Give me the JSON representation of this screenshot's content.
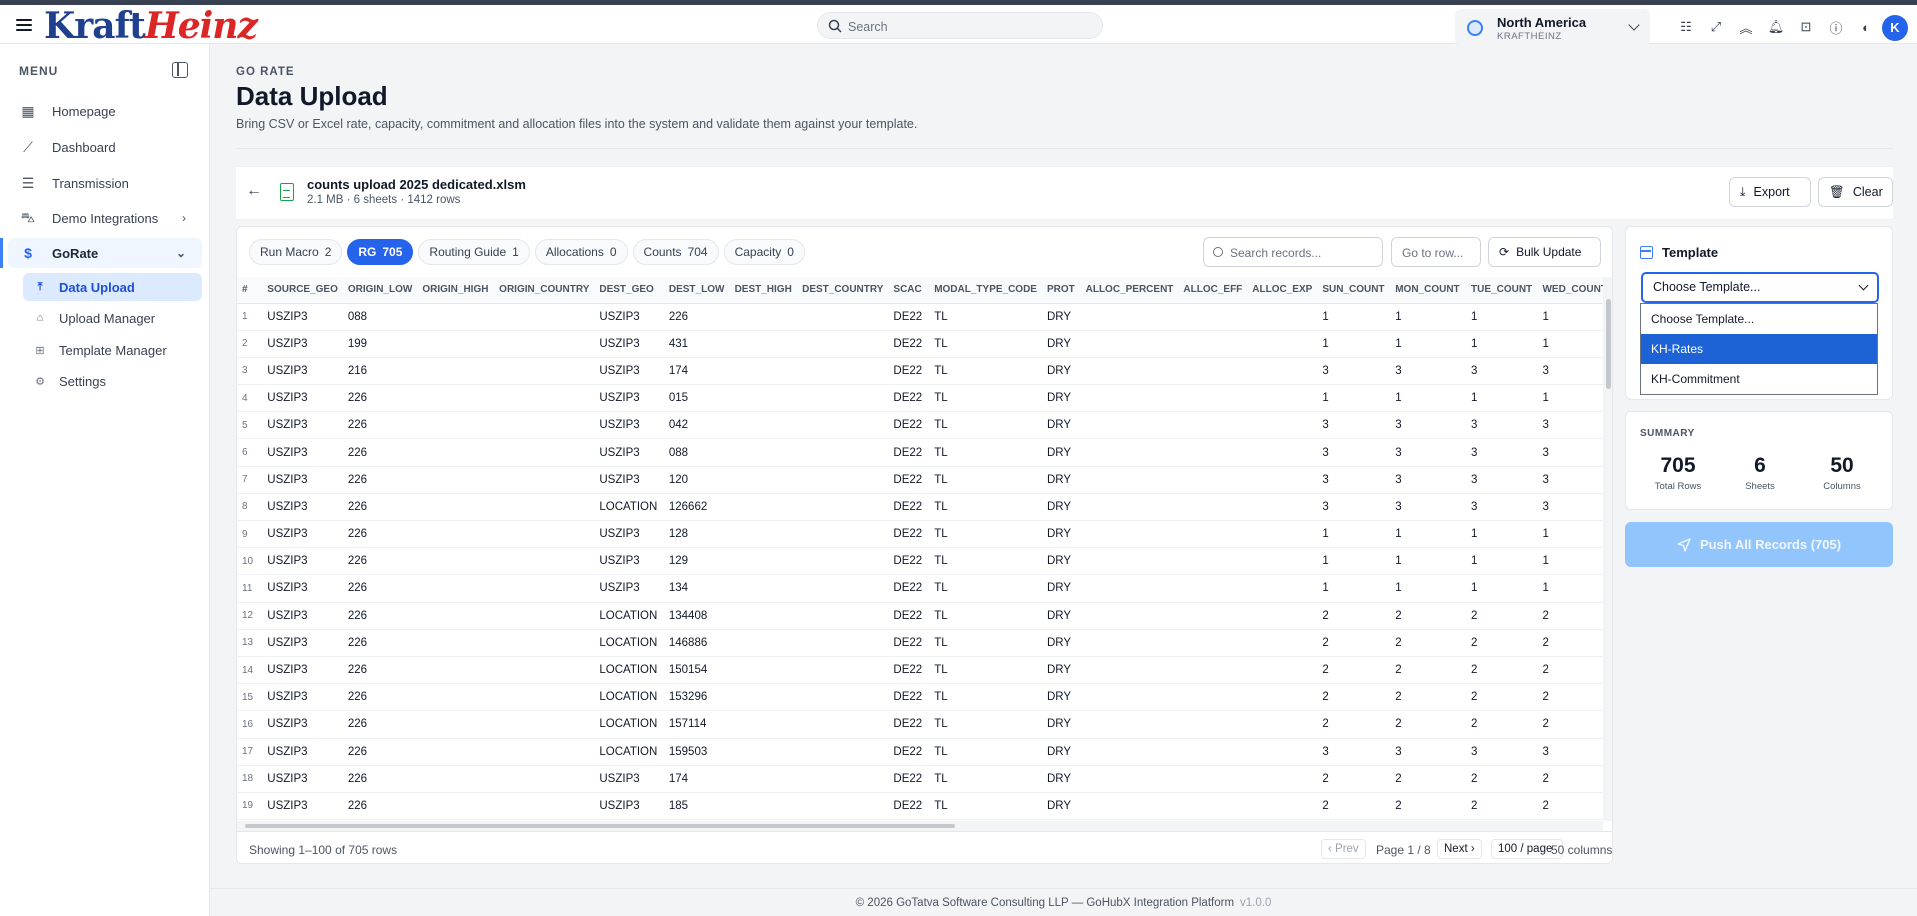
{
  "brand": {
    "part1": "Kraft",
    "part2": "Heinz"
  },
  "search": {
    "placeholder": "Search"
  },
  "region": {
    "name": "North America",
    "sub": "KRAFTHEINZ"
  },
  "avatar": "K",
  "sidebar": {
    "menu_label": "MENU",
    "items": [
      {
        "label": "Homepage",
        "icon": "building-icon"
      },
      {
        "label": "Dashboard",
        "icon": "chart-line-icon"
      },
      {
        "label": "Transmission",
        "icon": "server-icon"
      },
      {
        "label": "Demo Integrations",
        "icon": "car-icon"
      },
      {
        "label": "GoRate",
        "icon": "dollar-icon"
      }
    ],
    "subitems": [
      {
        "label": "Data Upload",
        "icon": "upload-icon"
      },
      {
        "label": "Upload Manager",
        "icon": "inbox-icon"
      },
      {
        "label": "Template Manager",
        "icon": "table-icon"
      },
      {
        "label": "Settings",
        "icon": "gear-icon"
      }
    ]
  },
  "page": {
    "crumb": "GO RATE",
    "title": "Data Upload",
    "description": "Bring CSV or Excel rate, capacity, commitment and allocation files into the system and validate them against your template."
  },
  "file": {
    "name": "counts upload 2025 dedicated.xlsm",
    "meta": "2.1 MB · 6 sheets · 1412 rows",
    "export_label": "Export",
    "clear_label": "Clear"
  },
  "tabs": [
    {
      "label": "Run Macro",
      "count": "2"
    },
    {
      "label": "RG",
      "count": "705"
    },
    {
      "label": "Routing Guide",
      "count": "1"
    },
    {
      "label": "Allocations",
      "count": "0"
    },
    {
      "label": "Counts",
      "count": "704"
    },
    {
      "label": "Capacity",
      "count": "0"
    }
  ],
  "table_tools": {
    "search_placeholder": "Search records...",
    "goto_placeholder": "Go to row...",
    "bulk_label": "Bulk Update"
  },
  "table": {
    "columns": [
      "#",
      "SOURCE_GEO",
      "ORIGIN_LOW",
      "ORIGIN_HIGH",
      "ORIGIN_COUNTRY",
      "DEST_GEO",
      "DEST_LOW",
      "DEST_HIGH",
      "DEST_COUNTRY",
      "SCAC",
      "MODAL_TYPE_CODE",
      "PROT",
      "ALLOC_PERCENT",
      "ALLOC_EFF",
      "ALLOC_EXP",
      "SUN_COUNT",
      "MON_COUNT",
      "TUE_COUNT",
      "WED_COUNT"
    ],
    "rows": [
      [
        "1",
        "USZIP3",
        "088",
        "",
        "",
        "USZIP3",
        "226",
        "",
        "",
        "DE22",
        "TL",
        "DRY",
        "",
        "",
        "",
        "1",
        "1",
        "1",
        "1"
      ],
      [
        "2",
        "USZIP3",
        "199",
        "",
        "",
        "USZIP3",
        "431",
        "",
        "",
        "DE22",
        "TL",
        "DRY",
        "",
        "",
        "",
        "1",
        "1",
        "1",
        "1"
      ],
      [
        "3",
        "USZIP3",
        "216",
        "",
        "",
        "USZIP3",
        "174",
        "",
        "",
        "DE22",
        "TL",
        "DRY",
        "",
        "",
        "",
        "3",
        "3",
        "3",
        "3"
      ],
      [
        "4",
        "USZIP3",
        "226",
        "",
        "",
        "USZIP3",
        "015",
        "",
        "",
        "DE22",
        "TL",
        "DRY",
        "",
        "",
        "",
        "1",
        "1",
        "1",
        "1"
      ],
      [
        "5",
        "USZIP3",
        "226",
        "",
        "",
        "USZIP3",
        "042",
        "",
        "",
        "DE22",
        "TL",
        "DRY",
        "",
        "",
        "",
        "3",
        "3",
        "3",
        "3"
      ],
      [
        "6",
        "USZIP3",
        "226",
        "",
        "",
        "USZIP3",
        "088",
        "",
        "",
        "DE22",
        "TL",
        "DRY",
        "",
        "",
        "",
        "3",
        "3",
        "3",
        "3"
      ],
      [
        "7",
        "USZIP3",
        "226",
        "",
        "",
        "USZIP3",
        "120",
        "",
        "",
        "DE22",
        "TL",
        "DRY",
        "",
        "",
        "",
        "3",
        "3",
        "3",
        "3"
      ],
      [
        "8",
        "USZIP3",
        "226",
        "",
        "",
        "LOCATION",
        "126662",
        "",
        "",
        "DE22",
        "TL",
        "DRY",
        "",
        "",
        "",
        "3",
        "3",
        "3",
        "3"
      ],
      [
        "9",
        "USZIP3",
        "226",
        "",
        "",
        "USZIP3",
        "128",
        "",
        "",
        "DE22",
        "TL",
        "DRY",
        "",
        "",
        "",
        "1",
        "1",
        "1",
        "1"
      ],
      [
        "10",
        "USZIP3",
        "226",
        "",
        "",
        "USZIP3",
        "129",
        "",
        "",
        "DE22",
        "TL",
        "DRY",
        "",
        "",
        "",
        "1",
        "1",
        "1",
        "1"
      ],
      [
        "11",
        "USZIP3",
        "226",
        "",
        "",
        "USZIP3",
        "134",
        "",
        "",
        "DE22",
        "TL",
        "DRY",
        "",
        "",
        "",
        "1",
        "1",
        "1",
        "1"
      ],
      [
        "12",
        "USZIP3",
        "226",
        "",
        "",
        "LOCATION",
        "134408",
        "",
        "",
        "DE22",
        "TL",
        "DRY",
        "",
        "",
        "",
        "2",
        "2",
        "2",
        "2"
      ],
      [
        "13",
        "USZIP3",
        "226",
        "",
        "",
        "LOCATION",
        "146886",
        "",
        "",
        "DE22",
        "TL",
        "DRY",
        "",
        "",
        "",
        "2",
        "2",
        "2",
        "2"
      ],
      [
        "14",
        "USZIP3",
        "226",
        "",
        "",
        "LOCATION",
        "150154",
        "",
        "",
        "DE22",
        "TL",
        "DRY",
        "",
        "",
        "",
        "2",
        "2",
        "2",
        "2"
      ],
      [
        "15",
        "USZIP3",
        "226",
        "",
        "",
        "LOCATION",
        "153296",
        "",
        "",
        "DE22",
        "TL",
        "DRY",
        "",
        "",
        "",
        "2",
        "2",
        "2",
        "2"
      ],
      [
        "16",
        "USZIP3",
        "226",
        "",
        "",
        "LOCATION",
        "157114",
        "",
        "",
        "DE22",
        "TL",
        "DRY",
        "",
        "",
        "",
        "2",
        "2",
        "2",
        "2"
      ],
      [
        "17",
        "USZIP3",
        "226",
        "",
        "",
        "LOCATION",
        "159503",
        "",
        "",
        "DE22",
        "TL",
        "DRY",
        "",
        "",
        "",
        "3",
        "3",
        "3",
        "3"
      ],
      [
        "18",
        "USZIP3",
        "226",
        "",
        "",
        "USZIP3",
        "174",
        "",
        "",
        "DE22",
        "TL",
        "DRY",
        "",
        "",
        "",
        "2",
        "2",
        "2",
        "2"
      ],
      [
        "19",
        "USZIP3",
        "226",
        "",
        "",
        "USZIP3",
        "185",
        "",
        "",
        "DE22",
        "TL",
        "DRY",
        "",
        "",
        "",
        "2",
        "2",
        "2",
        "2"
      ]
    ]
  },
  "pagination": {
    "showing": "Showing 1–100 of 705 rows",
    "prev": "‹ Prev",
    "page": "Page 1 / 8",
    "next": "Next ›",
    "per_page": "100 / page",
    "columns": "50 columns"
  },
  "template": {
    "heading": "Template",
    "selected": "Choose Template...",
    "options": [
      "Choose Template...",
      "KH-Rates",
      "KH-Commitment"
    ],
    "highlighted_option": "KH-Rates"
  },
  "summary": {
    "heading": "SUMMARY",
    "stats": [
      {
        "value": "705",
        "label": "Total Rows"
      },
      {
        "value": "6",
        "label": "Sheets"
      },
      {
        "value": "50",
        "label": "Columns"
      }
    ]
  },
  "push_label": "Push All Records (705)",
  "footer": {
    "text": "© 2026 GoTatva Software Consulting LLP — GoHubX Integration Platform",
    "version": "v1.0.0"
  },
  "colors": {
    "accent": "#2563eb",
    "brand_blue": "#1f3f8f",
    "brand_red": "#dc2626",
    "file_green": "#16a34a"
  }
}
